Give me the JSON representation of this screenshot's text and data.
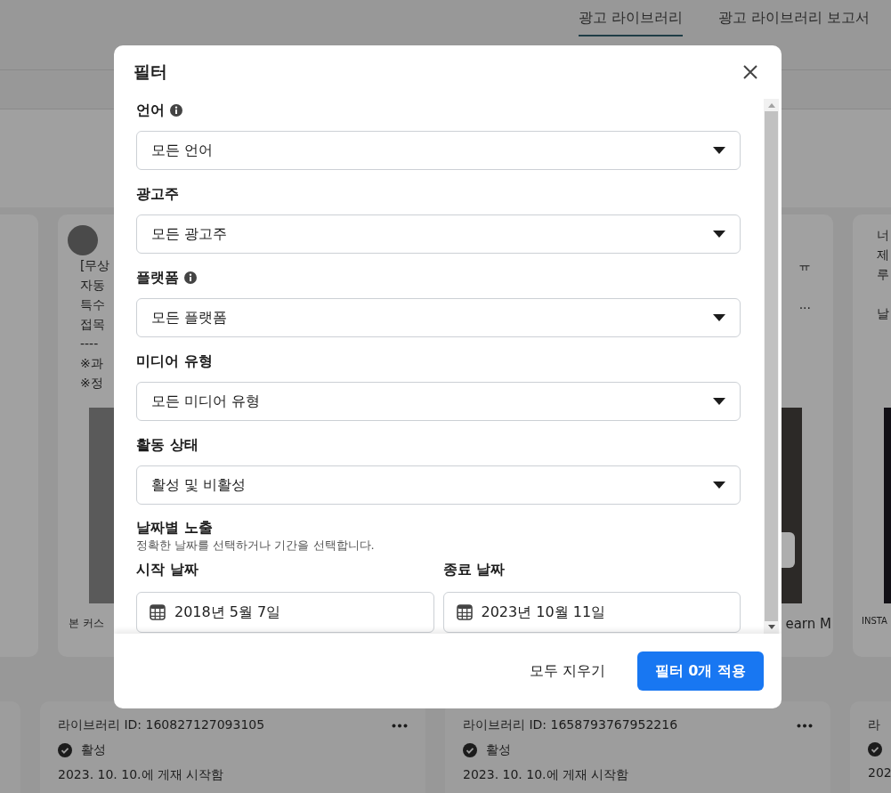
{
  "page_tabs": [
    {
      "label": "광고 라이브러리",
      "selected": true
    },
    {
      "label": "광고 라이브러리 보고서",
      "selected": false
    }
  ],
  "top_cards": [
    {
      "paragraphs": [
        [
          "[무상",
          "자동",
          "특수",
          "접목",
          "----",
          "※과",
          "※정"
        ]
      ],
      "footer": "본 커스",
      "kind": "post"
    },
    {
      "paragraphs": [
        [
          "ㅠ"
        ],
        [
          "..."
        ]
      ],
      "footer": "earn M",
      "kind": "carousel"
    },
    {
      "paragraphs": [
        [
          "너",
          "제",
          "루"
        ],
        [
          "날"
        ]
      ],
      "footer": "INSTA",
      "kind": "plain"
    }
  ],
  "bottom_cards": [
    {
      "library_id": "라이브러리 ID: 160827127093105",
      "status": "활성",
      "started": "2023. 10. 10.에 게재 시작함"
    },
    {
      "library_id": "라이브러리 ID: 1658793767952216",
      "status": "활성",
      "started": "2023. 10. 10.에 게재 시작함"
    },
    {
      "library_id": "라",
      "started": "202"
    }
  ],
  "filter_modal": {
    "title": "필터",
    "fields": [
      {
        "label": "언어",
        "info": true,
        "value": "모든 언어"
      },
      {
        "label": "광고주",
        "info": false,
        "value": "모든 광고주"
      },
      {
        "label": "플랫폼",
        "info": true,
        "value": "모든 플랫폼"
      },
      {
        "label": "미디어 유형",
        "info": false,
        "value": "모든 미디어 유형"
      },
      {
        "label": "활동 상태",
        "info": false,
        "value": "활성 및 비활성"
      }
    ],
    "date_section": {
      "title": "날짜별 노출",
      "hint": "정확한 날짜를 선택하거나 기간을 선택합니다.",
      "dates": [
        {
          "label": "시작 날짜",
          "value": "2018년 5월 7일"
        },
        {
          "label": "종료 날짜",
          "value": "2023년 10월 11일"
        }
      ]
    },
    "clear_button": "모두 지우기",
    "apply_button": "필터 0개 적용"
  }
}
